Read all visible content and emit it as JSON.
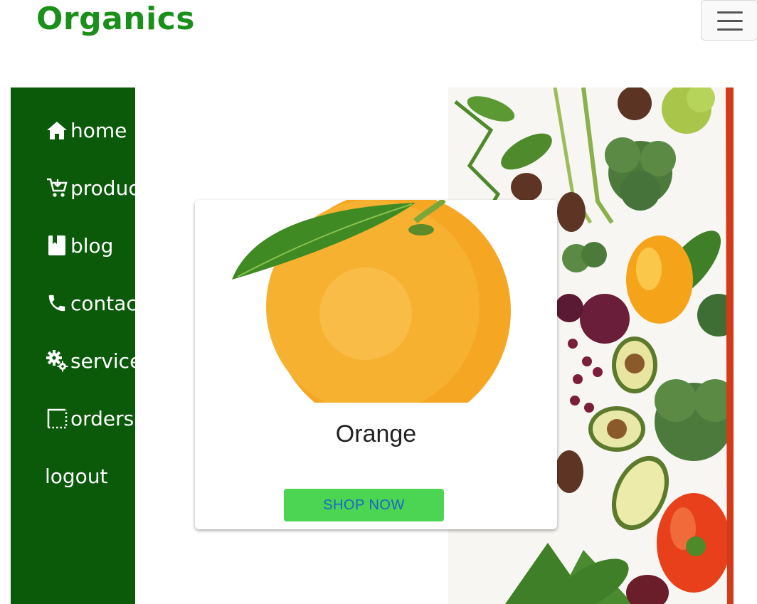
{
  "header": {
    "brand": "Organics",
    "menu_toggle_icon": "hamburger-icon"
  },
  "sidebar": {
    "items": [
      {
        "label": "home",
        "icon": "home-icon"
      },
      {
        "label": "products",
        "icon": "cart-icon"
      },
      {
        "label": "blog",
        "icon": "book-icon"
      },
      {
        "label": "contact",
        "icon": "phone-icon"
      },
      {
        "label": "services",
        "icon": "gears-icon"
      },
      {
        "label": "orders",
        "icon": "orders-icon"
      },
      {
        "label": "logout",
        "icon": ""
      }
    ]
  },
  "product_card": {
    "name": "Orange",
    "button_label": "SHOP NOW"
  },
  "colors": {
    "brand": "#1a8f1a",
    "sidebar_bg": "#0a5a0a",
    "button_bg": "#4cd453",
    "button_text": "#1a66c8"
  }
}
